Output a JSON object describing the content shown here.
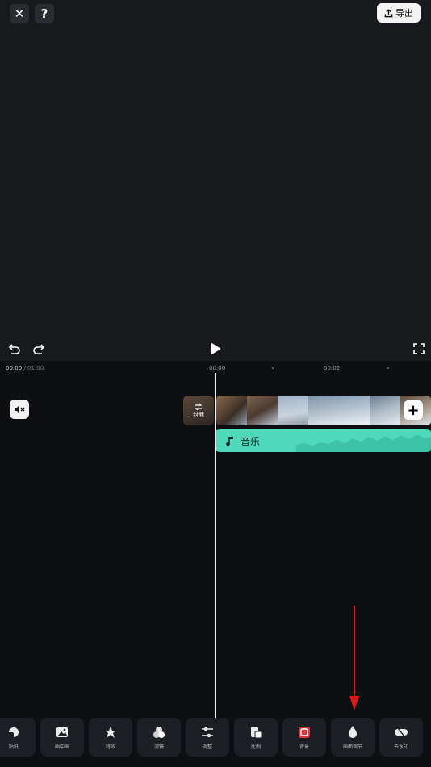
{
  "header": {
    "close_icon_glyph": "✕",
    "help_icon_glyph": "?",
    "export_label": "导出"
  },
  "timeline": {
    "current_time": "00:00",
    "total_time": " / 01:00",
    "ticks": [
      "00:00",
      "00:02"
    ],
    "cover_label": "封面",
    "audio_label": "音乐",
    "add_glyph": "+"
  },
  "toolbar": {
    "tools": [
      {
        "label": "贴纸",
        "icon": "sticker-icon"
      },
      {
        "label": "画中画",
        "icon": "picture-in-picture-icon"
      },
      {
        "label": "特效",
        "icon": "effects-icon"
      },
      {
        "label": "滤镜",
        "icon": "filter-icon"
      },
      {
        "label": "调整",
        "icon": "adjust-icon"
      },
      {
        "label": "比例",
        "icon": "ratio-icon"
      },
      {
        "label": "背景",
        "icon": "background-icon"
      },
      {
        "label": "画面调节",
        "icon": "color-drop-icon"
      },
      {
        "label": "去水印",
        "icon": "watermark-icon"
      }
    ]
  },
  "colors": {
    "audio_track": "#4fd9bb",
    "annotation_arrow": "#e01818",
    "background": "#17191d"
  }
}
